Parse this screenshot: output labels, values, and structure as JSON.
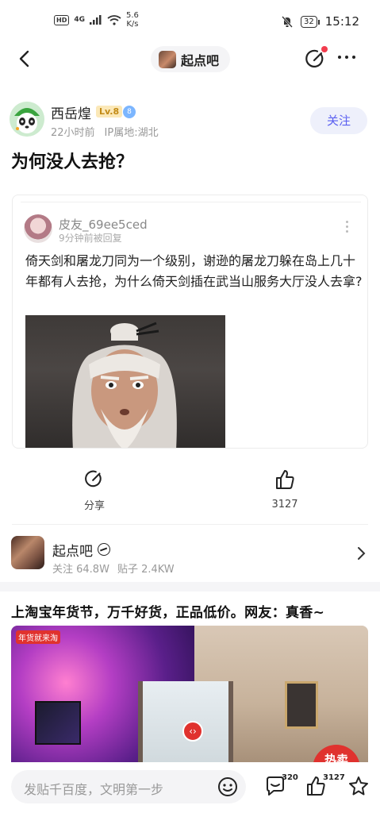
{
  "status_bar": {
    "hd": "HD",
    "net": "4G",
    "speed_top": "5.6",
    "speed_bottom": "K/s",
    "battery": "32",
    "time": "15:12"
  },
  "nav": {
    "forum_name": "起点吧"
  },
  "author": {
    "name": "西岳煌",
    "level": "Lv.8",
    "vip": "8",
    "time_ago": "22小时前",
    "ip_location": "IP属地:湖北",
    "follow_label": "关注"
  },
  "post": {
    "title": "为何没人去抢？"
  },
  "quote": {
    "user": "皮友_69ee5ced",
    "meta": "9分钟前被回复",
    "text": "倚天剑和屠龙刀同为一个级别，谢逊的屠龙刀躲在岛上几十年都有人去抢，为什么倚天剑插在武当山服务大厅没人去拿?"
  },
  "actions": {
    "share_label": "分享",
    "like_count": "3127"
  },
  "forum": {
    "name": "起点吧",
    "followers": "关注 64.8W",
    "posts": "贴子 2.4KW"
  },
  "ad": {
    "title": "上淘宝年货节，万千好货，正品低价。网友：真香~",
    "logo": "年货就来淘",
    "hot_label": "热卖"
  },
  "bottom_bar": {
    "placeholder": "发贴千百度，文明第一步",
    "comment_count": "320",
    "like_count": "3127"
  }
}
